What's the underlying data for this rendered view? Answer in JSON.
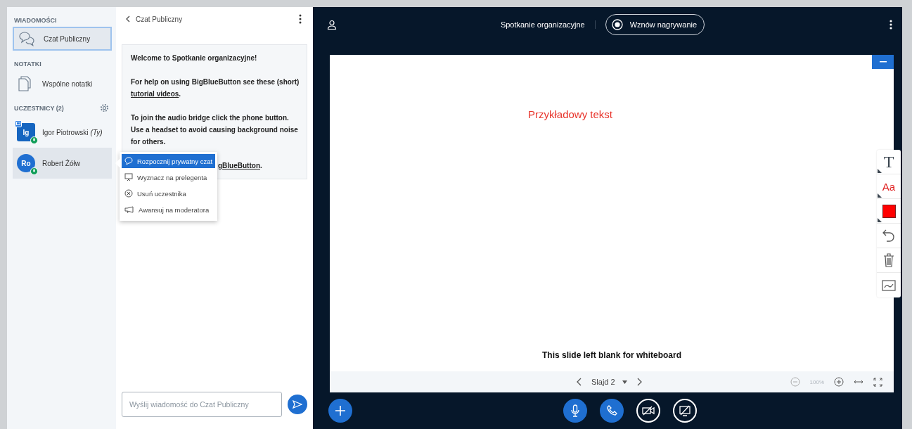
{
  "sidebar": {
    "messages_heading": "WIADOMOŚCI",
    "chats": [
      {
        "label": "Czat Publiczny",
        "selected": true
      }
    ],
    "notes_heading": "NOTATKI",
    "notes": [
      {
        "label": "Wspólne notatki"
      }
    ],
    "users_heading": "UCZESTNICY (2)",
    "users": [
      {
        "initials": "Ig",
        "name": "Igor Piotrowski",
        "suffix": "(Ty)",
        "kind": "presenter",
        "selected": false
      },
      {
        "initials": "Ro",
        "name": "Robert Żółw",
        "kind": "viewer",
        "selected": true
      }
    ]
  },
  "context_menu": {
    "items": [
      {
        "label": "Rozpocznij prywatny czat",
        "selected": true
      },
      {
        "label": "Wyznacz na prelegenta",
        "selected": false
      },
      {
        "label": "Usuń uczestnika",
        "selected": false
      },
      {
        "label": "Awansuj na moderatora",
        "selected": false
      }
    ]
  },
  "chat": {
    "title": "Czat Publiczny",
    "welcome": [
      {
        "text": "Welcome to **Spotkanie organizacyjne**!"
      },
      {
        "text": "For help on using BigBlueButton see these (short) ",
        "link": "tutorial videos",
        "after": "."
      },
      {
        "text": "To join the audio bridge click the phone button. Use a headset to avoid causing background noise for others."
      },
      {
        "link": "gBlueButton",
        "after": "."
      }
    ],
    "input": {
      "placeholder": "Wyślij wiadomość do Czat Publiczny"
    }
  },
  "topbar": {
    "meeting_title": "Spotkanie organizacyjne",
    "record_button": "Wznów nagrywanie"
  },
  "whiteboard": {
    "annotation": "Przykładowy tekst",
    "slide_caption": "This slide left blank for whiteboard",
    "slide_selector": "Slajd 2",
    "zoom": "100%"
  },
  "tools": [
    {
      "kind": "text",
      "label": "T"
    },
    {
      "kind": "font",
      "label": "Aa"
    },
    {
      "kind": "color",
      "color": "#ff0000"
    },
    {
      "kind": "undo"
    },
    {
      "kind": "clear"
    },
    {
      "kind": "multiuser"
    }
  ],
  "actions": [
    {
      "kind": "mic",
      "on": true
    },
    {
      "kind": "phone",
      "on": true
    },
    {
      "kind": "camera",
      "on": false
    },
    {
      "kind": "screen",
      "on": false
    }
  ]
}
